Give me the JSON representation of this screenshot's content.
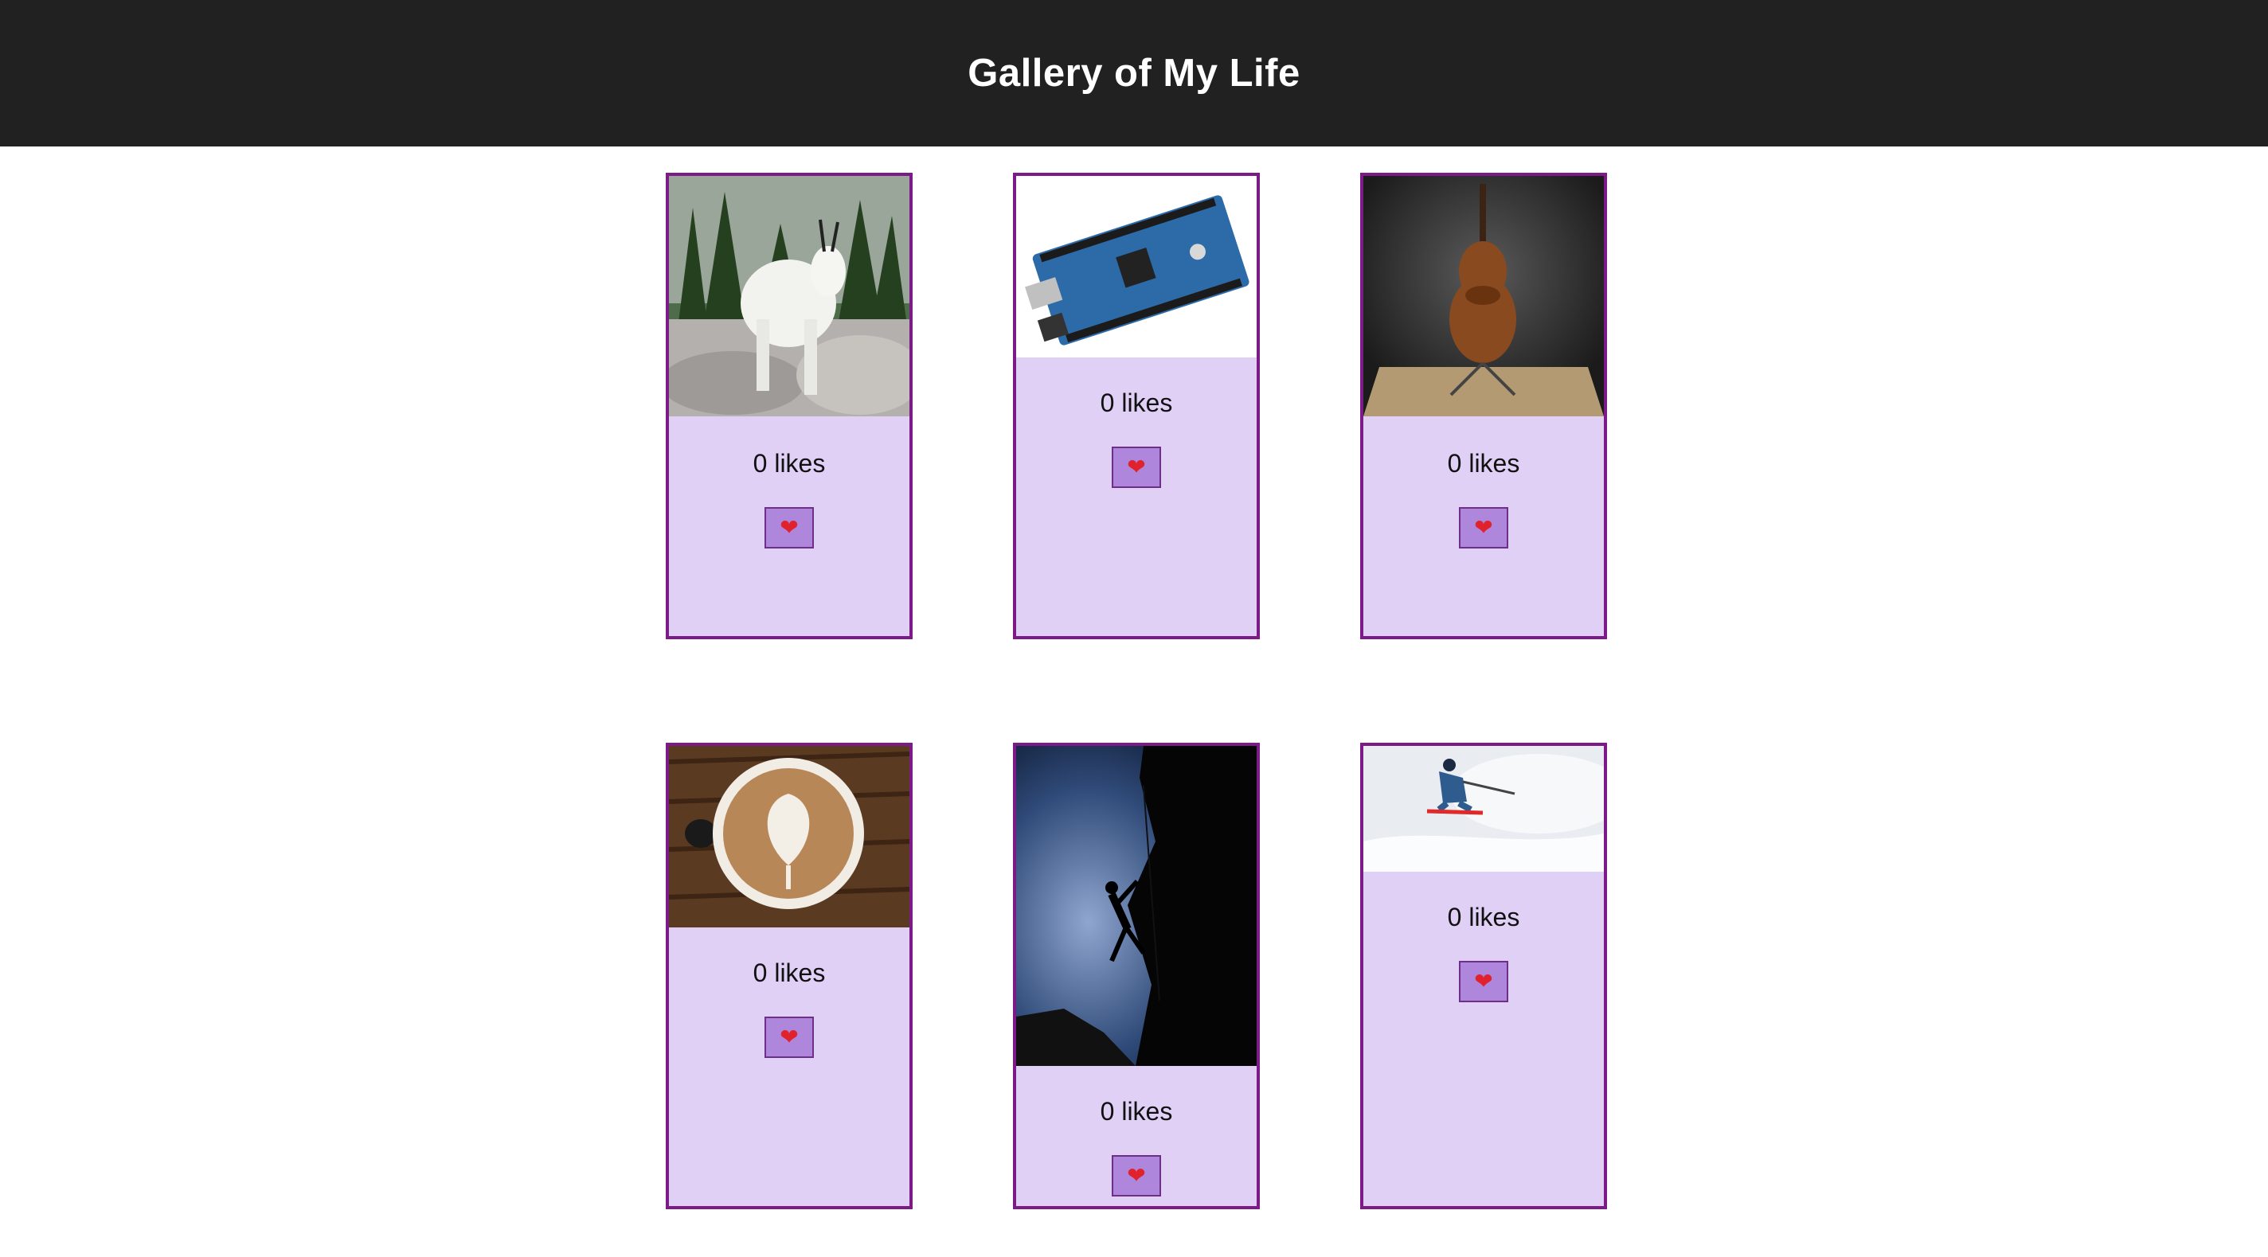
{
  "header": {
    "title": "Gallery of My Life"
  },
  "cards": [
    {
      "likes_text": "0 likes",
      "photo_icon": "mountain-goat-photo",
      "button_icon": "heart-icon"
    },
    {
      "likes_text": "0 likes",
      "photo_icon": "arduino-board-photo",
      "button_icon": "heart-icon"
    },
    {
      "likes_text": "0 likes",
      "photo_icon": "cello-photo",
      "button_icon": "heart-icon"
    },
    {
      "likes_text": "0 likes",
      "photo_icon": "latte-art-photo",
      "button_icon": "heart-icon"
    },
    {
      "likes_text": "0 likes",
      "photo_icon": "rock-climber-photo",
      "button_icon": "heart-icon"
    },
    {
      "likes_text": "0 likes",
      "photo_icon": "skier-photo",
      "button_icon": "heart-icon"
    }
  ],
  "colors": {
    "header_bg": "#212121",
    "card_bg": "#e0d0f6",
    "card_border": "#7c1a88",
    "button_bg": "#ae86dc",
    "heart": "#e0222c"
  }
}
